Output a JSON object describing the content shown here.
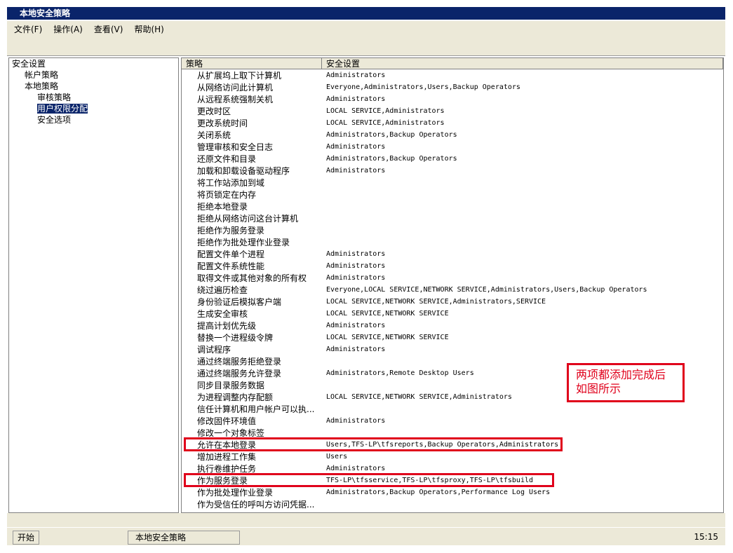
{
  "window": {
    "title": "本地安全策略"
  },
  "menu": [
    "文件(F)",
    "操作(A)",
    "查看(V)",
    "帮助(H)"
  ],
  "tree": [
    {
      "label": "安全设置",
      "level": 0,
      "selected": false
    },
    {
      "label": "帐户策略",
      "level": 1,
      "selected": false
    },
    {
      "label": "本地策略",
      "level": 1,
      "selected": false
    },
    {
      "label": "审核策略",
      "level": 2,
      "selected": false
    },
    {
      "label": "用户权限分配",
      "level": 2,
      "selected": true
    },
    {
      "label": "安全选项",
      "level": 2,
      "selected": false
    }
  ],
  "table": {
    "headers": [
      "策略",
      "安全设置"
    ],
    "rows": [
      [
        "从扩展坞上取下计算机",
        "Administrators"
      ],
      [
        "从网络访问此计算机",
        "Everyone,Administrators,Users,Backup Operators"
      ],
      [
        "从远程系统强制关机",
        "Administrators"
      ],
      [
        "更改时区",
        "LOCAL SERVICE,Administrators"
      ],
      [
        "更改系统时间",
        "LOCAL SERVICE,Administrators"
      ],
      [
        "关闭系统",
        "Administrators,Backup Operators"
      ],
      [
        "管理审核和安全日志",
        "Administrators"
      ],
      [
        "还原文件和目录",
        "Administrators,Backup Operators"
      ],
      [
        "加载和卸载设备驱动程序",
        "Administrators"
      ],
      [
        "将工作站添加到域",
        ""
      ],
      [
        "将页锁定在内存",
        ""
      ],
      [
        "拒绝本地登录",
        ""
      ],
      [
        "拒绝从网络访问这台计算机",
        ""
      ],
      [
        "拒绝作为服务登录",
        ""
      ],
      [
        "拒绝作为批处理作业登录",
        ""
      ],
      [
        "配置文件单个进程",
        "Administrators"
      ],
      [
        "配置文件系统性能",
        "Administrators"
      ],
      [
        "取得文件或其他对象的所有权",
        "Administrators"
      ],
      [
        "绕过遍历检查",
        "Everyone,LOCAL SERVICE,NETWORK SERVICE,Administrators,Users,Backup Operators"
      ],
      [
        "身份验证后模拟客户端",
        "LOCAL SERVICE,NETWORK SERVICE,Administrators,SERVICE"
      ],
      [
        "生成安全审核",
        "LOCAL SERVICE,NETWORK SERVICE"
      ],
      [
        "提高计划优先级",
        "Administrators"
      ],
      [
        "替换一个进程级令牌",
        "LOCAL SERVICE,NETWORK SERVICE"
      ],
      [
        "调试程序",
        "Administrators"
      ],
      [
        "通过终端服务拒绝登录",
        ""
      ],
      [
        "通过终端服务允许登录",
        "Administrators,Remote Desktop Users"
      ],
      [
        "同步目录服务数据",
        ""
      ],
      [
        "为进程调整内存配额",
        "LOCAL SERVICE,NETWORK SERVICE,Administrators"
      ],
      [
        "信任计算机和用户帐户可以执...",
        ""
      ],
      [
        "修改固件环境值",
        "Administrators"
      ],
      [
        "修改一个对象标签",
        ""
      ],
      [
        "允许在本地登录",
        "Users,TFS-LP\\tfsreports,Backup Operators,Administrators"
      ],
      [
        "增加进程工作集",
        "Users"
      ],
      [
        "执行卷维护任务",
        "Administrators"
      ],
      [
        "作为服务登录",
        "TFS-LP\\tfsservice,TFS-LP\\tfsproxy,TFS-LP\\tfsbuild"
      ],
      [
        "作为批处理作业登录",
        "Administrators,Backup Operators,Performance Log Users"
      ],
      [
        "作为受信任的呼叫方访问凭据...",
        ""
      ]
    ]
  },
  "annotation": {
    "text": "两项都添加完成后如图所示"
  },
  "taskbar": {
    "start": "开始",
    "task": "本地安全策略",
    "clock": "15:15"
  }
}
